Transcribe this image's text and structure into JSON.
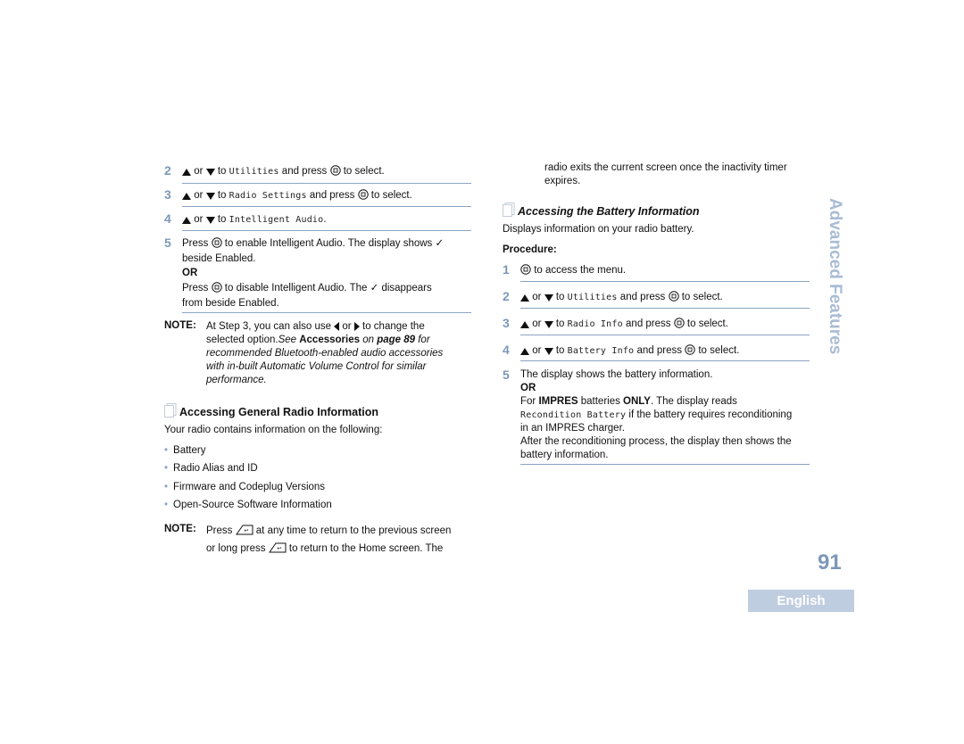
{
  "left": {
    "steps_top": [
      {
        "num": "2",
        "pre": " or ",
        "mid": " to ",
        "mono": "Utilities",
        "post1": " and press ",
        "post2": " to select."
      },
      {
        "num": "3",
        "pre": " or ",
        "mid": " to ",
        "mono": "Radio Settings",
        "post1": " and press ",
        "post2": " to select."
      },
      {
        "num": "4",
        "pre": " or ",
        "mid": " to ",
        "mono": "Intelligent Audio",
        "post1": ".",
        "post2": ""
      }
    ],
    "step5": {
      "num": "5",
      "line1_a": "Press ",
      "line1_b": " to enable Intelligent Audio. The display shows ✓",
      "line2": "beside Enabled.",
      "or": "OR",
      "line3_a": "Press ",
      "line3_b": " to disable Intelligent Audio. The ✓ disappears",
      "line4": "from beside Enabled."
    },
    "note1": {
      "label": "NOTE:",
      "l1_a": "At Step 3, you can also use ",
      "l1_b": " or ",
      "l1_c": " to change the",
      "l2_a": "selected option.",
      "l2_b": "See ",
      "l2_c": "Accessories",
      "l2_d": " on ",
      "l2_e": "page 89",
      "l2_f": " for",
      "l3": "recommended Bluetooth-enabled audio accessories",
      "l4": "with in-built Automatic Volume Control for similar",
      "l5": "performance."
    },
    "section_heading": "Accessing General Radio Information",
    "intro": "Your radio contains information on the following:",
    "bullets": [
      "Battery",
      "Radio Alias and ID",
      "Firmware and Codeplug Versions",
      "Open-Source Software Information"
    ],
    "note2": {
      "label": "NOTE:",
      "l1_a": "Press ",
      "l1_b": " at any time to return to the previous screen",
      "l2_a": "or long press ",
      "l2_b": " to return to the Home screen. The"
    }
  },
  "right": {
    "note_cont_l1": "radio exits the current screen once the inactivity timer",
    "note_cont_l2": "expires.",
    "section_heading": "Accessing the Battery Information",
    "intro": "Displays information on your radio battery.",
    "procedure_label": "Procedure:",
    "step1": {
      "num": "1",
      "post": " to access the menu."
    },
    "steps": [
      {
        "num": "2",
        "pre": " or ",
        "mid": " to ",
        "mono": "Utilities",
        "post1": " and press ",
        "post2": " to select."
      },
      {
        "num": "3",
        "pre": " or ",
        "mid": " to ",
        "mono": "Radio Info",
        "post1": " and press ",
        "post2": " to select."
      },
      {
        "num": "4",
        "pre": " or ",
        "mid": " to ",
        "mono": "Battery Info",
        "post1": " and press ",
        "post2": " to select."
      }
    ],
    "step5": {
      "num": "5",
      "l1": "The display shows the battery information.",
      "or": "OR",
      "l3_a": "For ",
      "l3_b": "IMPRES",
      "l3_c": " batteries ",
      "l3_d": "ONLY",
      "l3_e": ". The display reads",
      "l4_mono": "Recondition Battery",
      "l4_b": " if the battery requires reconditioning",
      "l5": "in an IMPRES charger.",
      "l6": "After the reconditioning process, the display then shows the",
      "l7": "battery information."
    }
  },
  "side_title": "Advanced Features",
  "page_number": "91",
  "language_tab": "English",
  "colors": {
    "accent": "#7d98b8",
    "rule": "#8aa3c4",
    "tab_bg": "#bfcde0",
    "side_title": "#a8bcd4"
  }
}
